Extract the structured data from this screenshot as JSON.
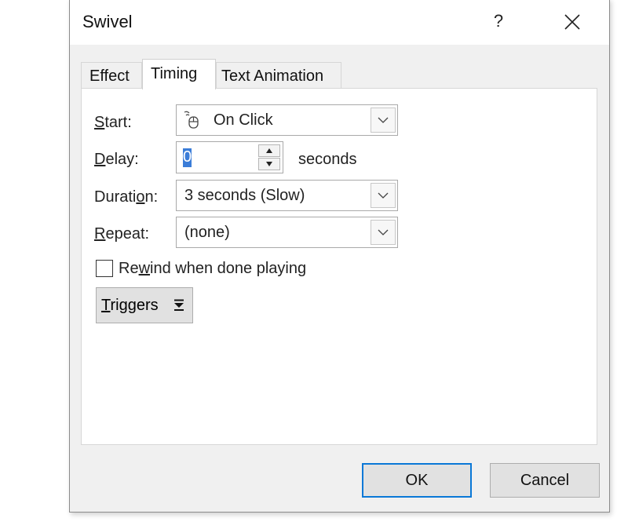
{
  "dialog": {
    "title": "Swivel",
    "help_glyph": "?"
  },
  "tabs": [
    {
      "label": "Effect",
      "active": false
    },
    {
      "label": "Timing",
      "active": true
    },
    {
      "label": "Text Animation",
      "active": false
    }
  ],
  "timing": {
    "start": {
      "label_ul": "S",
      "label_rest": "tart:",
      "value": "On Click",
      "icon": "mouse-icon"
    },
    "delay": {
      "label_ul": "D",
      "label_rest": "elay:",
      "value": "0",
      "unit": "seconds"
    },
    "duration": {
      "label_pre": "Durati",
      "label_ul": "o",
      "label_rest": "n:",
      "value": "3 seconds (Slow)"
    },
    "repeat": {
      "label_ul": "R",
      "label_rest": "epeat:",
      "value": "(none)"
    },
    "rewind": {
      "label_pre": "Re",
      "label_ul": "w",
      "label_rest": "ind when done playing",
      "checked": false
    },
    "triggers": {
      "label_ul": "T",
      "label_rest": "riggers"
    }
  },
  "buttons": {
    "ok": "OK",
    "cancel": "Cancel"
  },
  "colors": {
    "dialog_bg": "#f0f0f0",
    "accent": "#0a78d7",
    "selection": "#3b7dd8"
  }
}
